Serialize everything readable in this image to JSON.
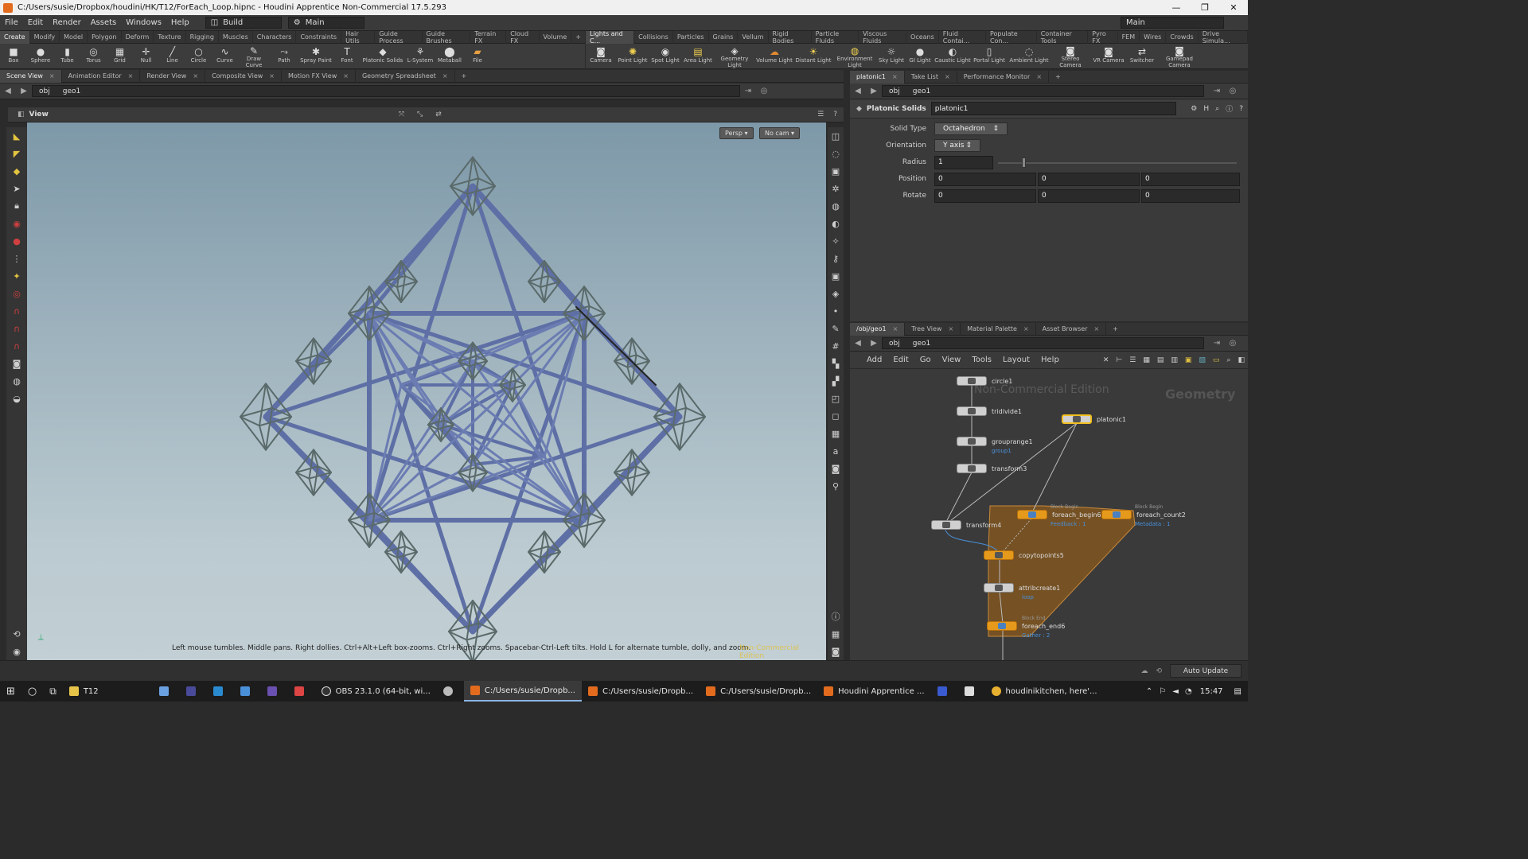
{
  "window": {
    "title": "C:/Users/susie/Dropbox/houdini/HK/T12/ForEach_Loop.hipnc - Houdini Apprentice Non-Commercial 17.5.293",
    "controls": [
      "—",
      "❐",
      "✕"
    ]
  },
  "menubar": {
    "items": [
      "File",
      "Edit",
      "Render",
      "Assets",
      "Windows",
      "Help"
    ],
    "desktop_combo": "Build",
    "context_combo": "Main",
    "right_combo": "Main"
  },
  "shelf_left": {
    "tabs": [
      "Create",
      "Modify",
      "Model",
      "Polygon",
      "Deform",
      "Texture",
      "Rigging",
      "Muscles",
      "Characters",
      "Constraints",
      "Hair Utils",
      "Guide Process",
      "Guide Brushes",
      "Terrain FX",
      "Cloud FX",
      "Volume"
    ],
    "tools": [
      "Box",
      "Sphere",
      "Tube",
      "Torus",
      "Grid",
      "Null",
      "Line",
      "Circle",
      "Curve",
      "Draw Curve",
      "Path",
      "Spray Paint",
      "Font",
      "Platonic Solids",
      "L-System",
      "Metaball",
      "File"
    ]
  },
  "shelf_right": {
    "tabs": [
      "Lights and C...",
      "Collisions",
      "Particles",
      "Grains",
      "Vellum",
      "Rigid Bodies",
      "Particle Fluids",
      "Viscous Fluids",
      "Oceans",
      "Fluid Contai...",
      "Populate Con...",
      "Container Tools",
      "Pyro FX",
      "FEM",
      "Wires",
      "Crowds",
      "Drive Simula..."
    ],
    "tools": [
      "Camera",
      "Point Light",
      "Spot Light",
      "Area Light",
      "Geometry Light",
      "Volume Light",
      "Distant Light",
      "Environment Light",
      "Sky Light",
      "GI Light",
      "Caustic Light",
      "Portal Light",
      "Ambient Light",
      "Stereo Camera",
      "VR Camera",
      "Switcher",
      "Gamepad Camera"
    ]
  },
  "left_pane": {
    "tabs": [
      "Scene View",
      "Animation Editor",
      "Render View",
      "Composite View",
      "Motion FX View",
      "Geometry Spreadsheet"
    ],
    "path": [
      "obj",
      "geo1"
    ],
    "view_label": "View",
    "persp_button": "Persp",
    "cam_button": "No cam",
    "hint": "Left mouse tumbles. Middle pans. Right dollies. Ctrl+Alt+Left box-zooms. Ctrl+Right zooms. Spacebar-Ctrl-Left tilts. Hold L for alternate tumble, dolly, and zoom.",
    "watermark": "Non-Commercial Edition"
  },
  "param_pane": {
    "tabs": [
      "platonic1",
      "Take List",
      "Performance Monitor"
    ],
    "path": [
      "obj",
      "geo1"
    ],
    "node_type": "Platonic Solids",
    "node_name": "platonic1",
    "solid_type_label": "Solid Type",
    "solid_type": "Octahedron",
    "orientation_label": "Orientation",
    "orientation": "Y axis",
    "radius_label": "Radius",
    "radius": "1",
    "radius_slider": 0.1,
    "position_label": "Position",
    "position": [
      "0",
      "0",
      "0"
    ],
    "rotate_label": "Rotate",
    "rotate": [
      "0",
      "0",
      "0"
    ]
  },
  "network_pane": {
    "tabs": [
      "/obj/geo1",
      "Tree View",
      "Material Palette",
      "Asset Browser"
    ],
    "path": [
      "obj",
      "geo1"
    ],
    "menu": [
      "Add",
      "Edit",
      "Go",
      "View",
      "Tools",
      "Layout",
      "Help"
    ],
    "watermark": "Non-Commercial Edition",
    "context_label": "Geometry",
    "nodes": {
      "circle1": "circle1",
      "tridivide1": "tridivide1",
      "grouprange1": "grouprange1",
      "grouprange1_sub": "group1",
      "transform3": "transform3",
      "platonic1": "platonic1",
      "transform4": "transform4",
      "foreach_begin6": "foreach_begin6",
      "foreach_begin6_tag": "Block Begin",
      "foreach_begin6_sub": "Feedback : 1",
      "foreach_count2": "foreach_count2",
      "foreach_count2_tag": "Block Begin",
      "foreach_count2_sub": "Metadata : 1",
      "copytopoints5": "copytopoints5",
      "attribcreate1": "attribcreate1",
      "attribcreate1_sub": "loop",
      "foreach_end6": "foreach_end6",
      "foreach_end6_tag": "Block End",
      "foreach_end6_sub": "Gather : 2"
    }
  },
  "statusbar": {
    "auto_update": "Auto Update"
  },
  "taskbar": {
    "items": [
      "T12",
      "OBS 23.1.0 (64-bit, wi...",
      "C:/Users/susie/Dropb...",
      "C:/Users/susie/Dropb...",
      "C:/Users/susie/Dropb...",
      "Houdini Apprentice ...",
      "houdinikitchen, here'..."
    ],
    "time": "15:47"
  },
  "colors": {
    "accent_orange": "#e69a1c",
    "viewport_top": "#7d98a8",
    "viewport_bottom": "#c2cfd4",
    "wire_blue": "#5e6fa6",
    "wire_grey": "#5a6a6a"
  }
}
